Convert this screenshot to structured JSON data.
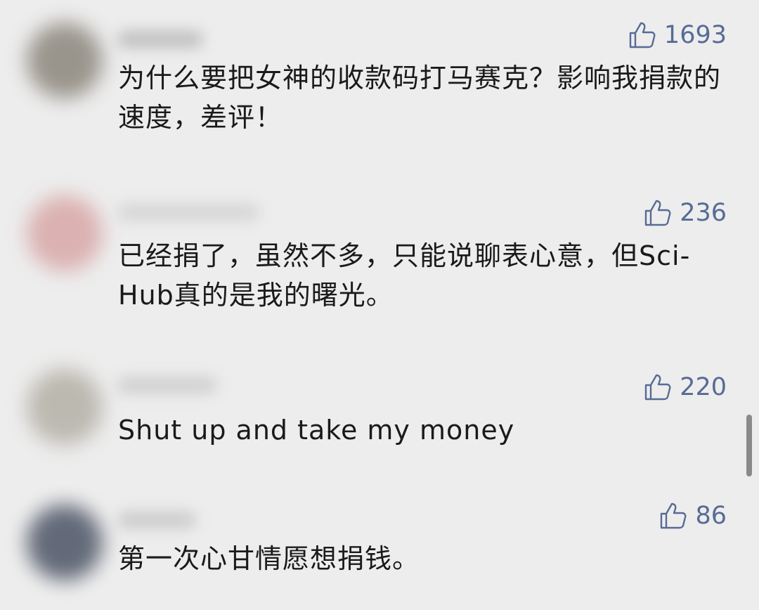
{
  "comments": [
    {
      "likes": "1693",
      "text": "为什么要把女神的收款码打马赛克？影响我捐款的速度，差评！",
      "avatar_color": "#8c867c"
    },
    {
      "likes": "236",
      "text": "已经捐了，虽然不多，只能说聊表心意，但Sci-Hub真的是我的曙光。",
      "avatar_color": "#d8a7a7"
    },
    {
      "likes": "220",
      "text": "Shut up and take my money",
      "avatar_color": "#b4b0a6"
    },
    {
      "likes": "86",
      "text": "第一次心甘情愿想捐钱。",
      "avatar_color": "#4b5364"
    }
  ],
  "icons": {
    "like": "thumbs-up-icon"
  },
  "colors": {
    "background": "#ededed",
    "like_text": "#576b95",
    "comment_text": "#1a1a1a",
    "scrollbar": "#8a8a8a"
  }
}
